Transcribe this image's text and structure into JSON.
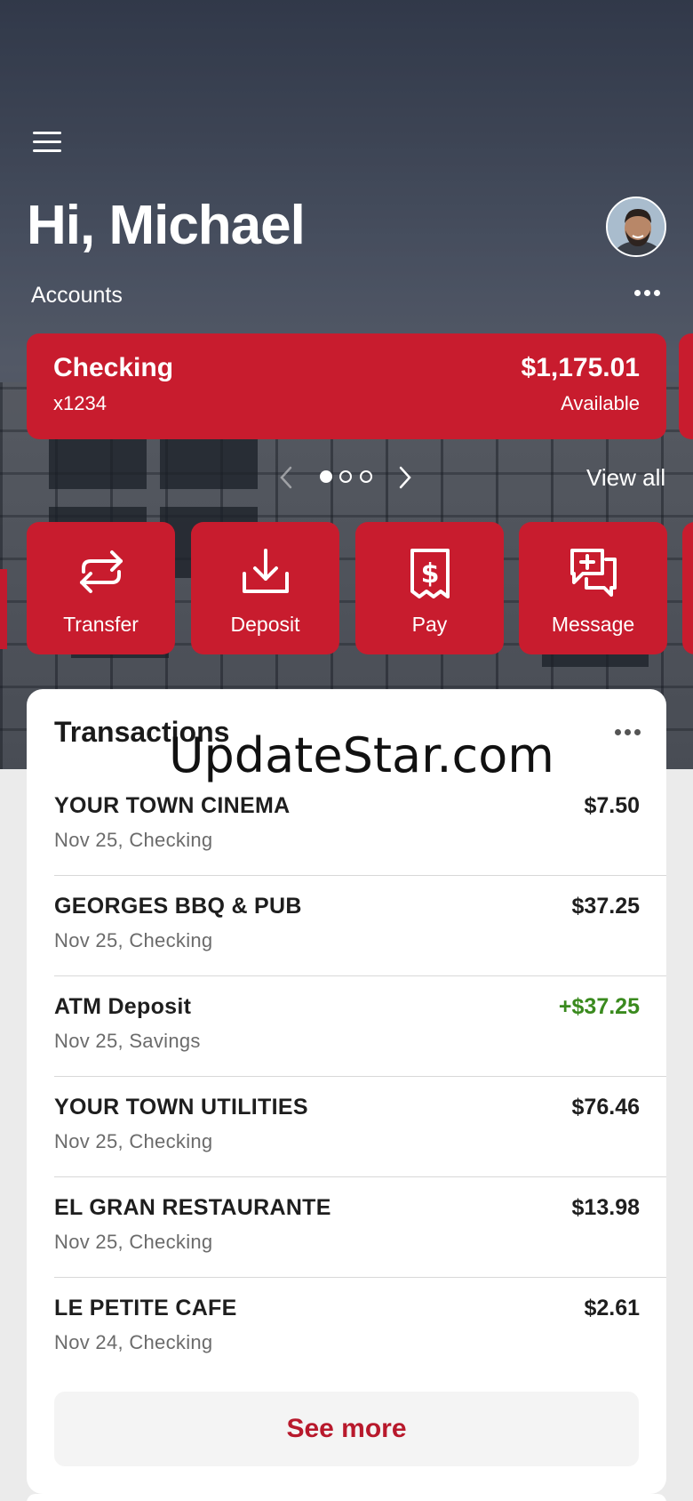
{
  "header": {
    "greeting": "Hi, Michael",
    "menu_icon": "hamburger-menu-icon",
    "avatar_icon": "user-avatar"
  },
  "accounts": {
    "label": "Accounts",
    "more_icon": "more-horizontal-icon",
    "card": {
      "name": "Checking",
      "number": "x1234",
      "balance": "$1,175.01",
      "balance_label": "Available"
    },
    "pager": {
      "total": 3,
      "active": 1
    },
    "view_all": "View all"
  },
  "actions": [
    {
      "label": "Transfer",
      "icon": "transfer-arrows-icon"
    },
    {
      "label": "Deposit",
      "icon": "download-tray-icon"
    },
    {
      "label": "Pay",
      "icon": "receipt-dollar-icon"
    },
    {
      "label": "Message",
      "icon": "message-plus-icon"
    }
  ],
  "transactions": {
    "title": "Transactions",
    "items": [
      {
        "merchant": "YOUR TOWN CINEMA",
        "meta": "Nov 25, Checking",
        "amount": "$7.50"
      },
      {
        "merchant": "GEORGES BBQ & PUB",
        "meta": "Nov 25, Checking",
        "amount": "$37.25"
      },
      {
        "merchant": "ATM Deposit",
        "meta": "Nov 25, Savings",
        "amount": "+$37.25"
      },
      {
        "merchant": "YOUR TOWN UTILITIES",
        "meta": "Nov 25, Checking",
        "amount": "$76.46"
      },
      {
        "merchant": "EL GRAN RESTAURANTE",
        "meta": "Nov 25, Checking",
        "amount": "$13.98"
      },
      {
        "merchant": "LE PETITE CAFE",
        "meta": "Nov 24, Checking",
        "amount": "$2.61"
      }
    ],
    "see_more": "See more"
  },
  "watermark": "UpdateStar.com",
  "colors": {
    "brand_red": "#c81c2e",
    "positive_green": "#3a8a1e",
    "see_more_text": "#b8192c"
  }
}
